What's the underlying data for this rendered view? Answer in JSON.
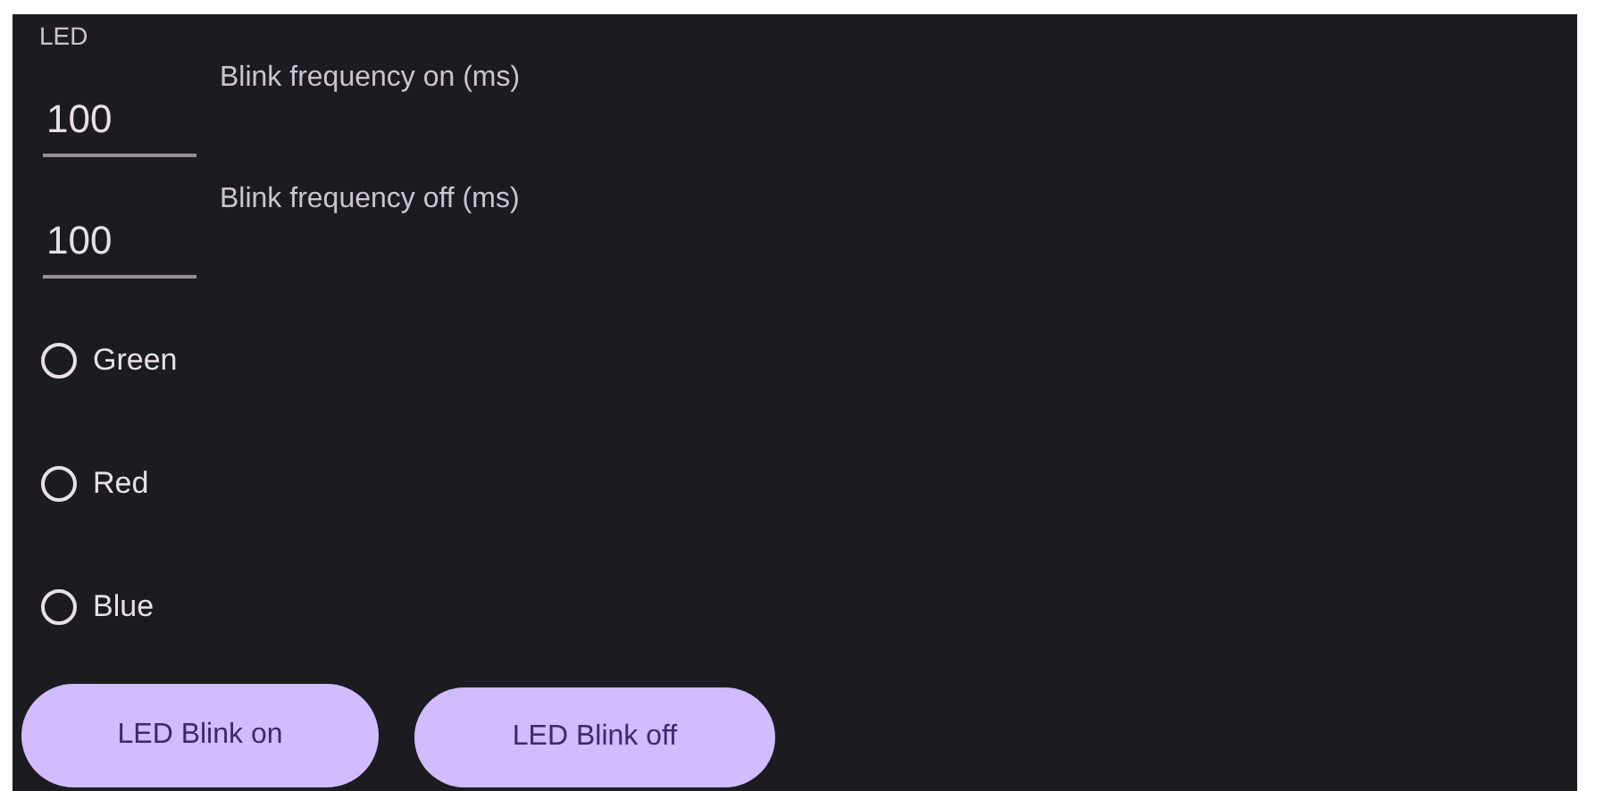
{
  "section": {
    "title": "LED"
  },
  "fields": [
    {
      "value": "100",
      "label": "Blink frequency on (ms)"
    },
    {
      "value": "100",
      "label": "Blink frequency off (ms)"
    }
  ],
  "radios": [
    {
      "label": "Green",
      "selected": false
    },
    {
      "label": "Red",
      "selected": false
    },
    {
      "label": "Blue",
      "selected": false
    }
  ],
  "buttons": [
    "LED Blink on",
    "LED Blink off"
  ]
}
